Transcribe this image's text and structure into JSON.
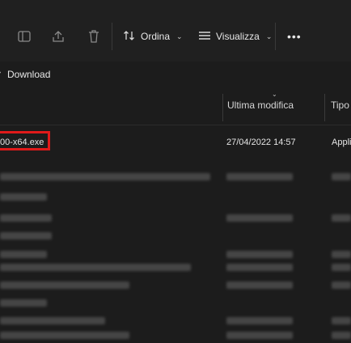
{
  "toolbar": {
    "sort_label": "Ordina",
    "view_label": "Visualizza",
    "more_label": "•••",
    "icons": [
      "share-icon",
      "export-icon",
      "delete-icon",
      "sort-icon",
      "view-icon",
      "more-icon"
    ]
  },
  "address": {
    "separator": "›",
    "current": "Download"
  },
  "columns": {
    "modified": "Ultima modifica",
    "type": "Tipo"
  },
  "selected_file": {
    "name": "00-x64.exe",
    "modified": "27/04/2022 14:57",
    "type": "Appli"
  },
  "colors": {
    "background": "#1c1c1c",
    "toolbar": "#202020",
    "highlight": "#e01a1a"
  }
}
